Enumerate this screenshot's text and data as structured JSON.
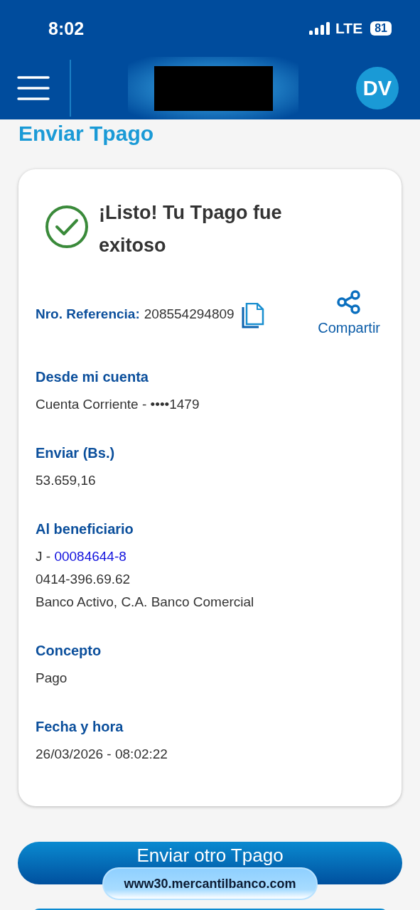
{
  "status_bar": {
    "time": "8:02",
    "network": "LTE",
    "battery": "81"
  },
  "header": {
    "avatar": "DV"
  },
  "page_title": "Enviar Tpago",
  "result": {
    "title": "¡Listo! Tu Tpago fue exitoso",
    "reference_label": "Nro. Referencia:",
    "reference": "208554294809",
    "share": "Compartir"
  },
  "details": [
    {
      "label": "Desde mi cuenta",
      "lines": [
        {
          "text": "Cuenta Corriente - ••••1479"
        }
      ]
    },
    {
      "label": "Enviar (Bs.)",
      "lines": [
        {
          "text": "53.659,16"
        }
      ]
    },
    {
      "label": "Al beneficiario",
      "lines": [
        {
          "text": "J - ",
          "link": "00084644-8"
        },
        {
          "text": "0414-396.69.62"
        },
        {
          "text": "Banco Activo, C.A. Banco Comercial"
        }
      ]
    },
    {
      "label": "Concepto",
      "lines": [
        {
          "text": "Pago"
        }
      ]
    },
    {
      "label": "Fecha y hora",
      "lines": [
        {
          "text": "26/03/2026 - 08:02:22"
        }
      ]
    }
  ],
  "primary_button": "Enviar otro Tpago",
  "url_pill": "www30.mercantilbanco.com"
}
